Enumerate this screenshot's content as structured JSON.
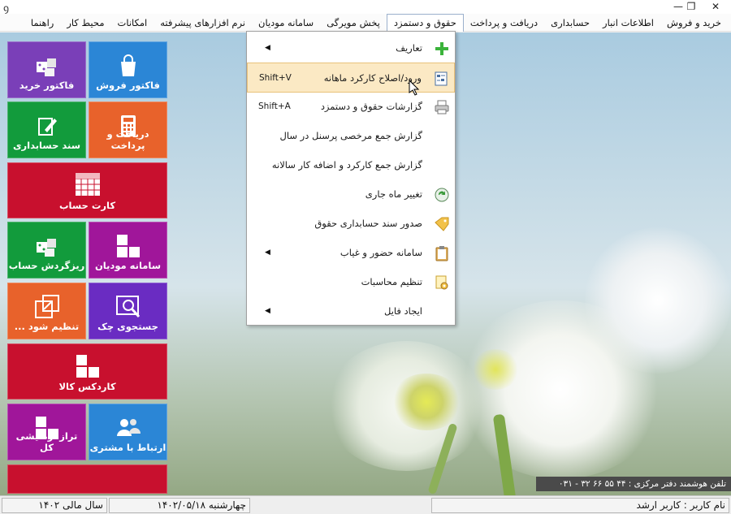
{
  "window": {
    "app_icon": "app-logo-icon",
    "controls": [
      "close",
      "maximize",
      "minimize"
    ]
  },
  "menubar": {
    "items": [
      {
        "label": "خرید و فروش"
      },
      {
        "label": "اطلاعات انبار"
      },
      {
        "label": "حسابداری"
      },
      {
        "label": "دریافت و پرداخت"
      },
      {
        "label": "حقوق و دستمزد"
      },
      {
        "label": "پخش مویرگی"
      },
      {
        "label": "سامانه مودیان"
      },
      {
        "label": "نرم افزارهای پیشرفته"
      },
      {
        "label": "امکانات"
      },
      {
        "label": "محیط کار"
      },
      {
        "label": "راهنما"
      }
    ]
  },
  "tiles": [
    {
      "label": "فاکتور فروش",
      "color": "#2b86d6",
      "icon": "shopping-bag-icon"
    },
    {
      "label": "فاکتور خرید",
      "color": "#7a3fb8",
      "icon": "dice-cubes-icon"
    },
    {
      "label": "دریافت و پرداخت",
      "color": "#e8622b",
      "icon": "calculator-icon"
    },
    {
      "label": "سند حسابداری",
      "color": "#129b3c",
      "icon": "pen-doc-icon"
    },
    {
      "label": "کارت حساب",
      "color": "#c8102e",
      "icon": "grid-table-icon"
    },
    {
      "label": "سامانه مودیان",
      "color": "#a0169a",
      "icon": "blocks-icon"
    },
    {
      "label": "ریزگردش حساب",
      "color": "#129b3c",
      "icon": "dice-cubes-icon"
    },
    {
      "label": "جستجوی چک",
      "color": "#6a2cc2",
      "icon": "search-window-icon"
    },
    {
      "label": "تنظیم شود ...",
      "color": "#e8622b",
      "icon": "external-window-icon"
    },
    {
      "label": "کاردکس کالا",
      "color": "#c8102e",
      "icon": "blocks-icon"
    },
    {
      "label": "ارتباط با مشتری",
      "color": "#2b86d6",
      "icon": "users-icon"
    },
    {
      "label": "تراز آزمایشی کل",
      "color": "#a0169a",
      "icon": "blocks-icon"
    },
    {
      "label": "",
      "color": "#c8102e",
      "icon": ""
    }
  ],
  "dropdown": {
    "parent": "حقوق و دستمزد",
    "items": [
      {
        "label": "تعاریف",
        "icon": "plus-icon",
        "submenu": true,
        "shortcut": ""
      },
      {
        "label": "ورود/اصلاح کارکرد ماهانه",
        "icon": "form-icon",
        "submenu": false,
        "shortcut": "Shift+V",
        "highlighted": true
      },
      {
        "label": "گزارشات حقوق و دستمزد",
        "icon": "printer-icon",
        "submenu": false,
        "shortcut": "Shift+A"
      },
      {
        "label": "گزارش جمع مرخصی پرسنل در سال",
        "icon": "",
        "submenu": false,
        "shortcut": ""
      },
      {
        "label": "گزارش جمع کارکرد و اضافه کار سالانه",
        "icon": "",
        "submenu": false,
        "shortcut": ""
      },
      {
        "label": "تغییر ماه جاری",
        "icon": "refresh-icon",
        "submenu": false,
        "shortcut": ""
      },
      {
        "label": "صدور سند حسابداری حقوق",
        "icon": "tag-icon",
        "submenu": false,
        "shortcut": ""
      },
      {
        "label": "سامانه حضور و غیاب",
        "icon": "clipboard-icon",
        "submenu": true,
        "shortcut": ""
      },
      {
        "label": "تنظیم محاسبات",
        "icon": "settings-doc-icon",
        "submenu": false,
        "shortcut": ""
      },
      {
        "label": "ایجاد فایل",
        "icon": "",
        "submenu": true,
        "shortcut": ""
      }
    ]
  },
  "banner": {
    "text": "تلفن هوشمند دفتر مرکزی :  ۴۴ ۵۵ ۶۶ ۳۲ - ۰۳۱"
  },
  "status": {
    "user": "نام کاربر : کاربر ارشد",
    "date": "چهارشنبه  ۱۴۰۲/۰۵/۱۸",
    "fiscal_year": "سال مالی ۱۴۰۲"
  }
}
